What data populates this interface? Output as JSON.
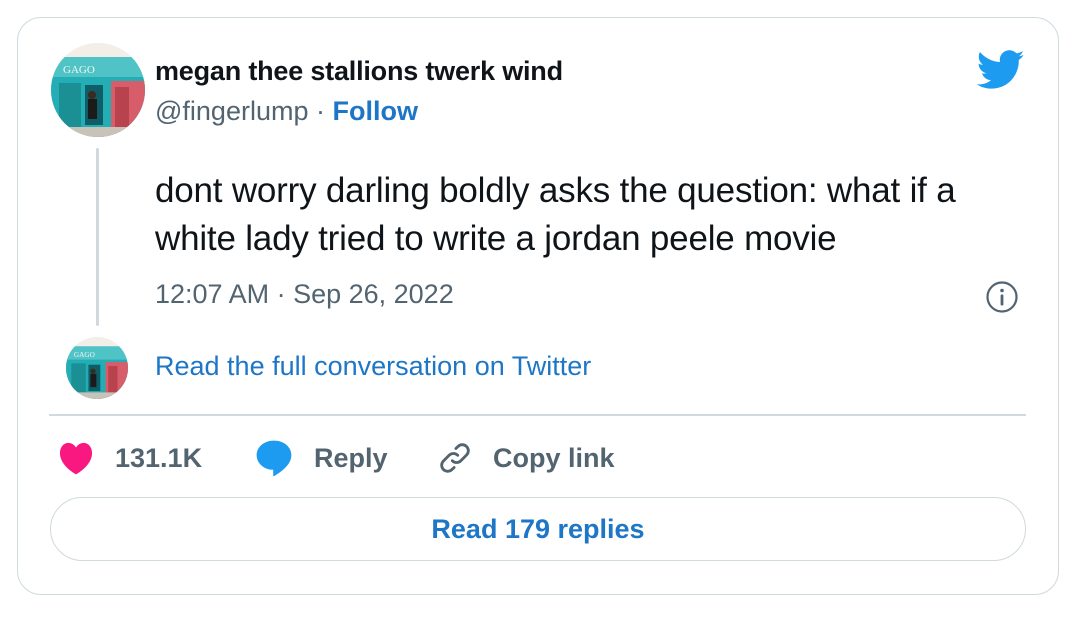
{
  "tweet": {
    "author": {
      "display_name": "megan thee stallions twerk wind",
      "handle": "@fingerlump",
      "separator": " · ",
      "follow_label": "Follow",
      "avatar_sign_text": "GAGO"
    },
    "text": "dont worry darling boldly asks the question: what if a white lady tried to write a jordan peele movie",
    "timestamp": "12:07 AM · Sep 26, 2022",
    "full_conversation_label": "Read the full conversation on Twitter",
    "actions": {
      "likes_count": "131.1K",
      "reply_label": "Reply",
      "copy_link_label": "Copy link"
    },
    "read_replies_label": "Read 179 replies"
  },
  "icons": {
    "brand": "twitter-bird-icon",
    "info": "info-icon",
    "like": "heart-icon",
    "reply": "speech-bubble-icon",
    "copy": "link-icon"
  },
  "colors": {
    "link_blue": "#1d76c6",
    "twitter_blue": "#1d9bf0",
    "like_pink": "#f91880",
    "muted_text": "#536471",
    "border": "#cfd9de"
  }
}
